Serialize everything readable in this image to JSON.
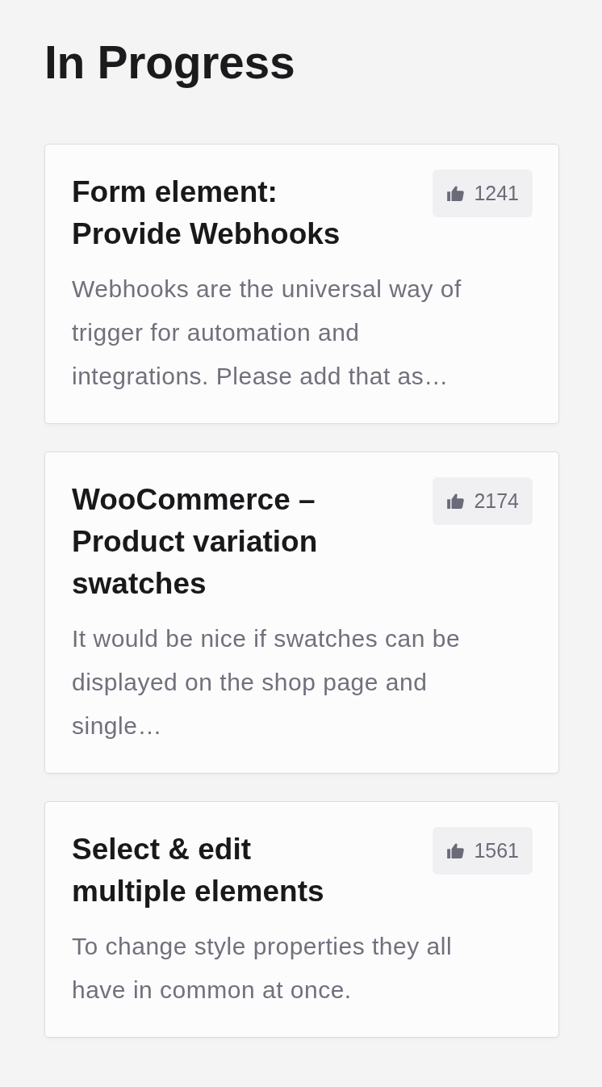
{
  "title": "In Progress",
  "cards": [
    {
      "title": "Form element: Provide Webhooks",
      "votes": "1241",
      "description": "Webhooks are the universal way of trigger for automation and integrations. Please add that as…"
    },
    {
      "title": "WooCommerce – Product variation swatches",
      "votes": "2174",
      "description": "It would be nice if swatches can be displayed on the shop page and single…"
    },
    {
      "title": "Select & edit multiple elements",
      "votes": "1561",
      "description": "To change style properties they all have in common at once."
    }
  ]
}
